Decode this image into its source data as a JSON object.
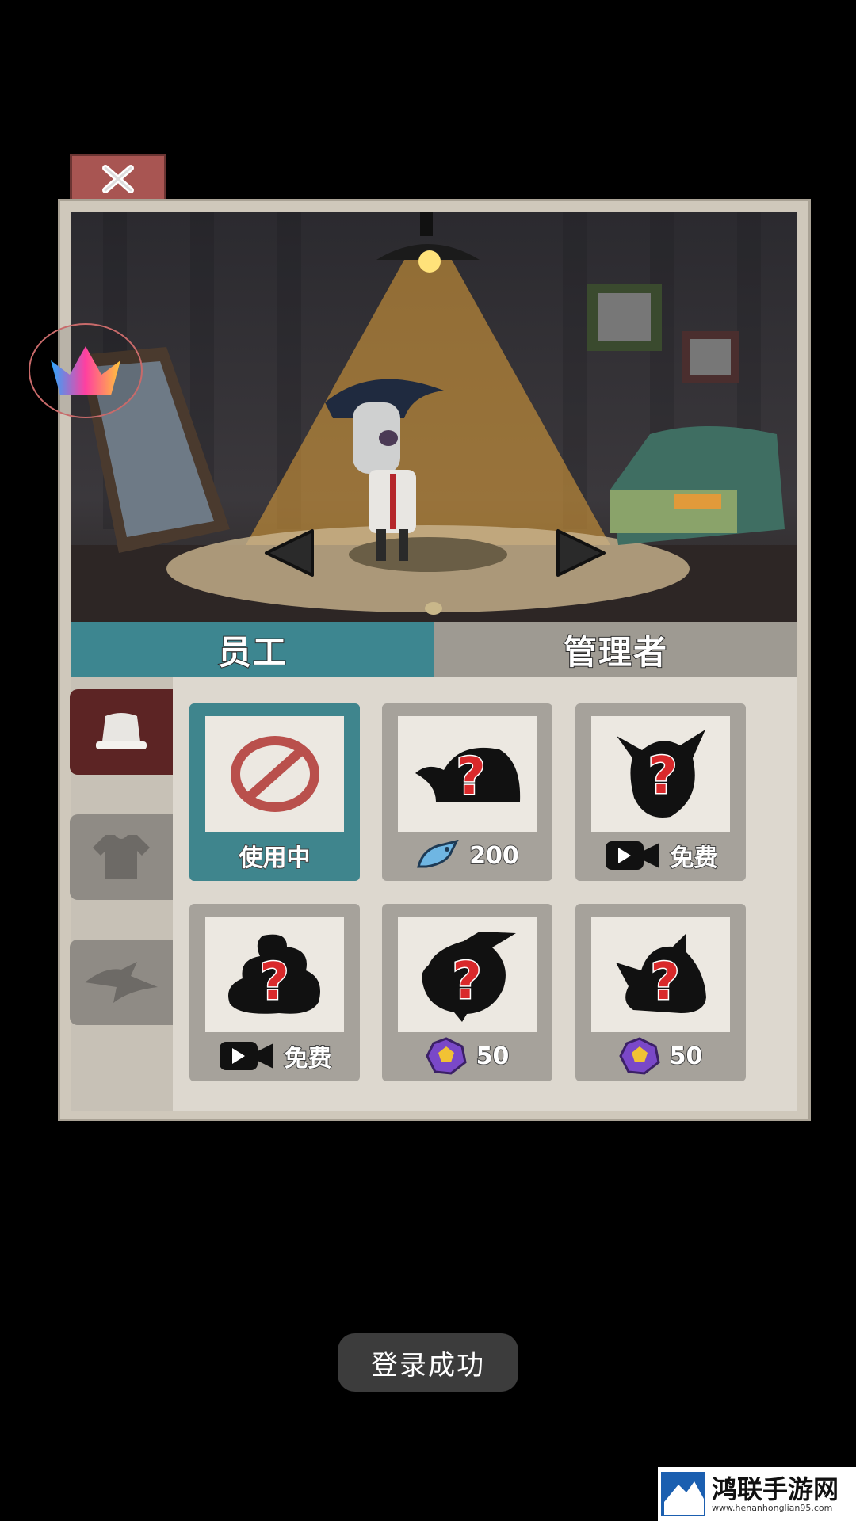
{
  "tabs": {
    "staff": "员工",
    "manager": "管理者"
  },
  "items": [
    {
      "price": "使用中",
      "currency": "none",
      "state": "selected",
      "shape": "none-icon"
    },
    {
      "price": "200",
      "currency": "fish-icon",
      "state": "locked",
      "shape": "helmet"
    },
    {
      "price": "免费",
      "currency": "video-icon",
      "state": "locked",
      "shape": "horned-hood"
    },
    {
      "price": "免费",
      "currency": "video-icon",
      "state": "locked",
      "shape": "swirl-hat"
    },
    {
      "price": "50",
      "currency": "gem-icon",
      "state": "locked",
      "shape": "bird-hat"
    },
    {
      "price": "50",
      "currency": "gem-icon",
      "state": "locked",
      "shape": "bunny-hood"
    }
  ],
  "toast": "登录成功",
  "watermark": {
    "title": "鸿联手游网",
    "url": "www.henanhonglian95.com"
  },
  "colors": {
    "selected": "#3f858d",
    "tab_active": "#3d8690",
    "tab_inactive": "#9e9a92",
    "close": "#a85552"
  }
}
